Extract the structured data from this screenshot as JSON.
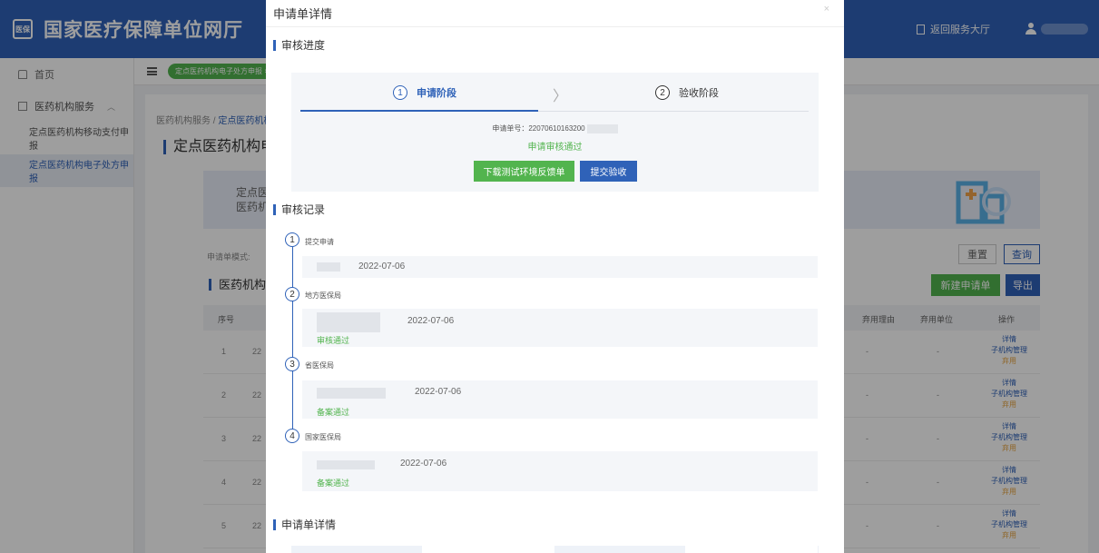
{
  "app": {
    "title": "国家医疗保障单位网厅",
    "logo": "医保",
    "return_hall": "返回服务大厅"
  },
  "sidebar": {
    "home": "首页",
    "group": "医药机构服务",
    "items": [
      "定点医药机构移动支付申报",
      "定点医药机构电子处方申报"
    ]
  },
  "tabs": {
    "active": "定点医药机构电子处方申报 ×"
  },
  "background": {
    "breadcrumb_root": "医药机构服务 / ",
    "breadcrumb_current": "定点医药机构",
    "page_title": "定点医药机构电子",
    "banner_line1": "定点医",
    "banner_line2": "医药机",
    "search_label": "申请单模式:",
    "btn_reset": "重置",
    "btn_query": "查询",
    "list_title": "医药机构电",
    "btn_new": "新建申请单",
    "btn_export": "导出",
    "columns": {
      "seq": "序号",
      "stop_reason": "弃用理由",
      "stop_unit": "弃用单位",
      "ops": "操作"
    },
    "rows": [
      {
        "seq": "1",
        "num": "22"
      },
      {
        "seq": "2",
        "num": "22"
      },
      {
        "seq": "3",
        "num": "22"
      },
      {
        "seq": "4",
        "num": "22"
      },
      {
        "seq": "5",
        "num": "22"
      }
    ],
    "dash": "-",
    "op_detail": "详情",
    "op_sub": "子机构管理",
    "op_disable": "弃用"
  },
  "modal": {
    "title": "申请单详情",
    "close": "×",
    "progress_title": "审核进度",
    "steps": [
      {
        "num": "1",
        "label": "申请阶段"
      },
      {
        "num": "2",
        "label": "验收阶段"
      }
    ],
    "step_arrow": "〉",
    "apply_no": "申请单号：220706101632​00",
    "apply_status": "申请审核通过",
    "btn_download": "下载测试环境反馈单",
    "btn_submit": "提交验收",
    "records_title": "审核记录",
    "records": [
      {
        "num": "1",
        "label": "提交申请",
        "date": "2022-07-06",
        "result": ""
      },
      {
        "num": "2",
        "label": "地方医保局",
        "date": "2022-07-06",
        "result": "审核通过"
      },
      {
        "num": "3",
        "label": "省医保局",
        "date": "2022-07-06",
        "result": "备案通过"
      },
      {
        "num": "4",
        "label": "国家医保局",
        "date": "2022-07-06",
        "result": "备案通过"
      }
    ],
    "detail_title": "申请单详情"
  }
}
